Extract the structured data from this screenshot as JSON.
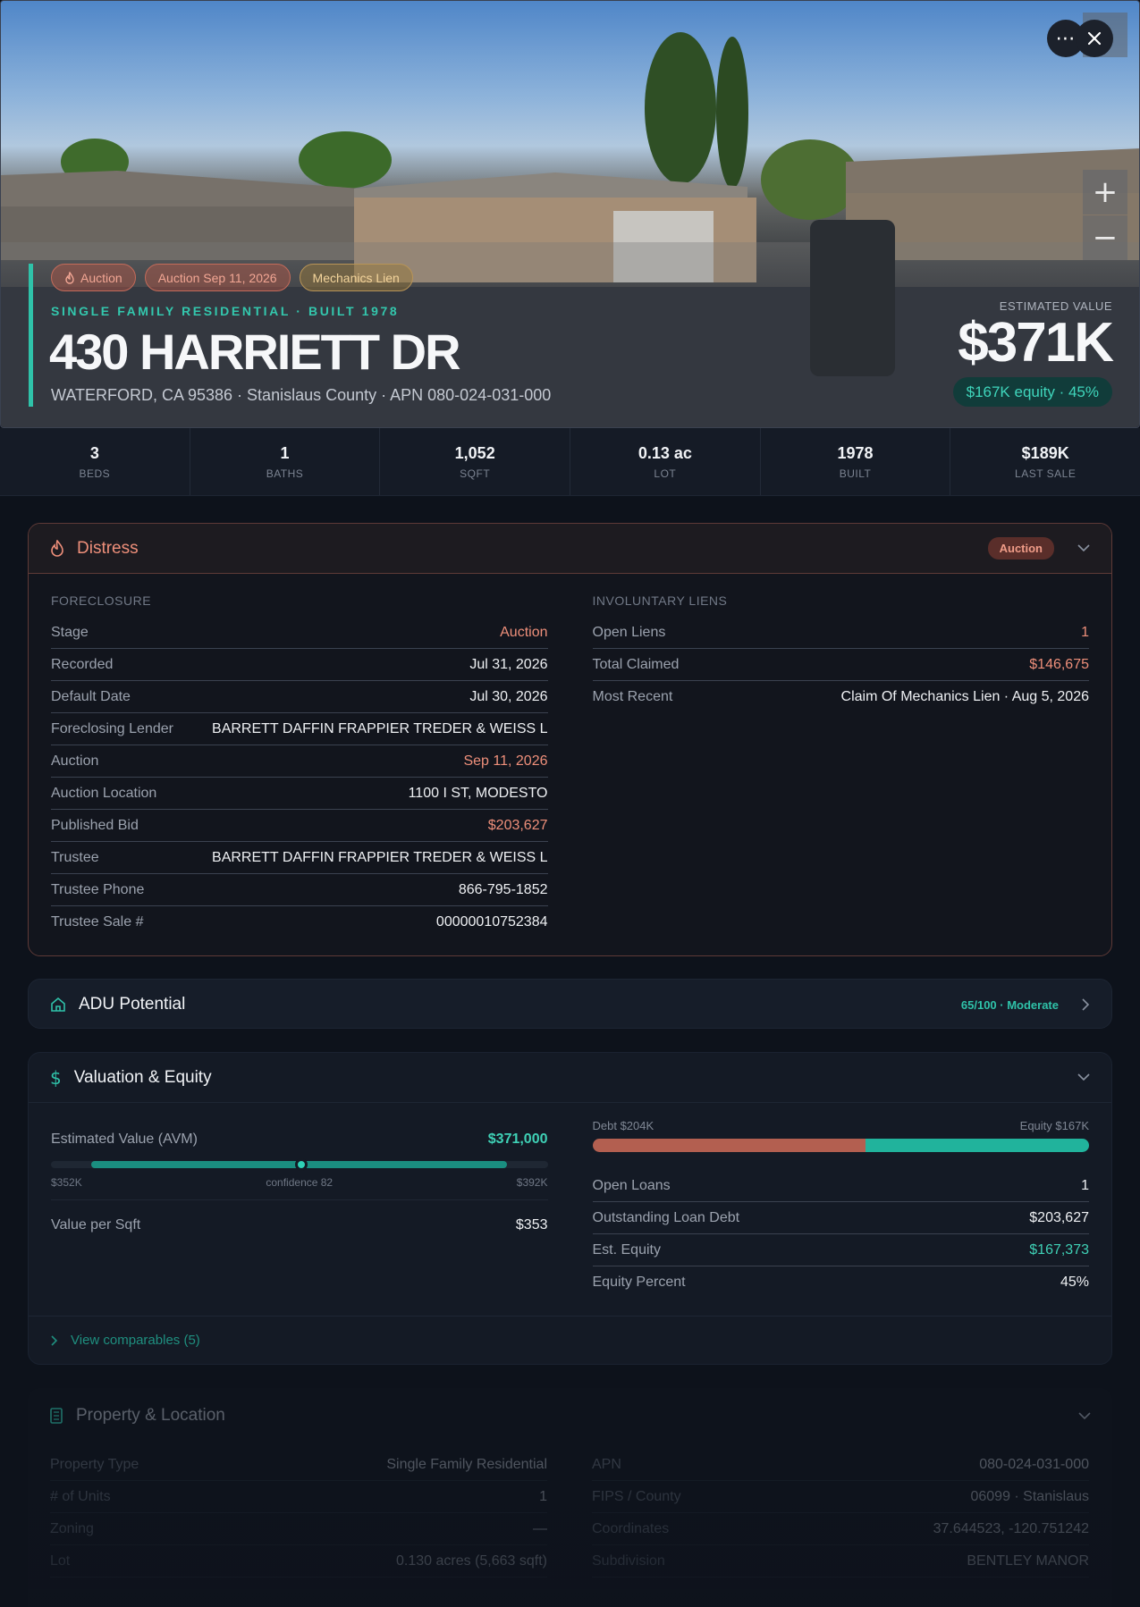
{
  "hero": {
    "badges": [
      {
        "label": "Auction",
        "icon": "flame-icon"
      },
      {
        "label": "Auction Sep 11, 2026"
      },
      {
        "label": "Mechanics Lien"
      }
    ],
    "eyebrow": "SINGLE FAMILY RESIDENTIAL · BUILT 1978",
    "address": "430 HARRIETT DR",
    "sub_address": "WATERFORD, CA 95386 · Stanislaus County · APN 080-024-031-000",
    "estimated_label": "ESTIMATED VALUE",
    "estimated_value": "$371K",
    "equity_pill": "$167K equity · 45%",
    "zoom_in": "+",
    "zoom_out": "−"
  },
  "stats": [
    {
      "value": "3",
      "label": "BEDS"
    },
    {
      "value": "1",
      "label": "BATHS"
    },
    {
      "value": "1,052",
      "label": "SQFT"
    },
    {
      "value": "0.13 ac",
      "label": "LOT"
    },
    {
      "value": "1978",
      "label": "BUILT"
    },
    {
      "value": "$189K",
      "label": "LAST SALE"
    }
  ],
  "distress": {
    "title": "Distress",
    "pill": "Auction",
    "foreclosure_label": "FORECLOSURE",
    "foreclosure": [
      {
        "k": "Stage",
        "v": "Auction",
        "tone": "red"
      },
      {
        "k": "Recorded",
        "v": "Jul 31, 2026"
      },
      {
        "k": "Default Date",
        "v": "Jul 30, 2026"
      },
      {
        "k": "Foreclosing Lender",
        "v": "BARRETT DAFFIN FRAPPIER TREDER & WEISS L"
      },
      {
        "k": "Auction",
        "v": "Sep 11, 2026",
        "tone": "red"
      },
      {
        "k": "Auction Location",
        "v": "1100 I ST, MODESTO"
      },
      {
        "k": "Published Bid",
        "v": "$203,627",
        "tone": "red"
      },
      {
        "k": "Trustee",
        "v": "BARRETT DAFFIN FRAPPIER TREDER & WEISS L"
      },
      {
        "k": "Trustee Phone",
        "v": "866-795-1852"
      },
      {
        "k": "Trustee Sale #",
        "v": "00000010752384"
      }
    ],
    "liens_label": "INVOLUNTARY LIENS",
    "liens": [
      {
        "k": "Open Liens",
        "v": "1",
        "tone": "red"
      },
      {
        "k": "Total Claimed",
        "v": "$146,675",
        "tone": "red"
      },
      {
        "k": "Most Recent",
        "v": "Claim Of Mechanics Lien · Aug 5, 2026"
      }
    ]
  },
  "adu": {
    "title": "ADU Potential",
    "score": "65/100 · Moderate"
  },
  "valuation": {
    "title": "Valuation & Equity",
    "avm_label": "Estimated Value (AVM)",
    "avm_value": "$371,000",
    "range_low": "$352K",
    "confidence": "confidence 82",
    "range_high": "$392K",
    "sqft_label": "Value per Sqft",
    "sqft_value": "$353",
    "debt_label": "Debt $204K",
    "equity_label": "Equity $167K",
    "equity_fraction": 0.45,
    "rows": [
      {
        "k": "Open Loans",
        "v": "1"
      },
      {
        "k": "Outstanding Loan Debt",
        "v": "$203,627"
      },
      {
        "k": "Est. Equity",
        "v": "$167,373",
        "tone": "teal"
      },
      {
        "k": "Equity Percent",
        "v": "45%"
      }
    ],
    "comparables": "View comparables (5)"
  },
  "property": {
    "title": "Property & Location",
    "left": [
      {
        "k": "Property Type",
        "v": "Single Family Residential"
      },
      {
        "k": "# of Units",
        "v": "1"
      },
      {
        "k": "Zoning",
        "v": "—"
      },
      {
        "k": "Lot",
        "v": "0.130 acres (5,663 sqft)"
      }
    ],
    "right": [
      {
        "k": "APN",
        "v": "080-024-031-000"
      },
      {
        "k": "FIPS / County",
        "v": "06099 · Stanislaus"
      },
      {
        "k": "Coordinates",
        "v": "37.644523, -120.751242"
      },
      {
        "k": "Subdivision",
        "v": "BENTLEY MANOR"
      }
    ]
  },
  "colors": {
    "accent_teal": "#2fc2a9",
    "distress_red": "#ee8f7a",
    "background": "#0d121b"
  }
}
